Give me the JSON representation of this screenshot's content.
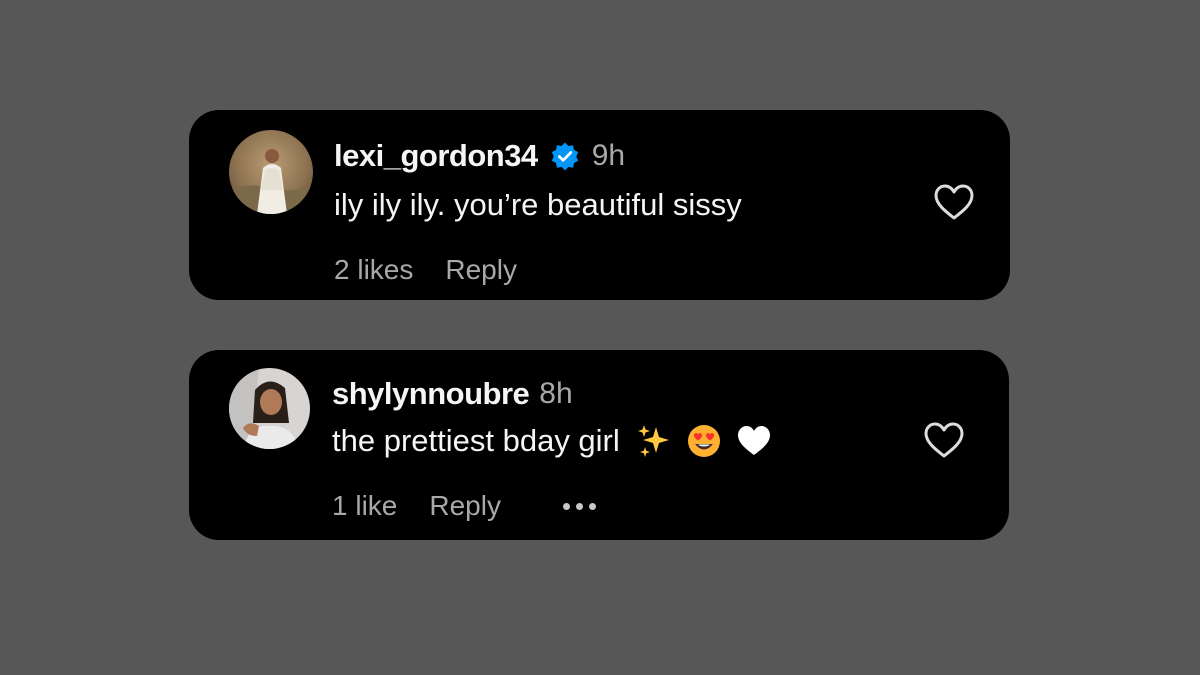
{
  "comments": [
    {
      "username": "lexi_gordon34",
      "verified": true,
      "time": "9h",
      "text": "ily ily ily. you’re beautiful sissy",
      "likes_label": "2 likes",
      "reply_label": "Reply",
      "emojis": []
    },
    {
      "username": "shylynnoubre",
      "verified": false,
      "time": "8h",
      "text": "the prettiest bday girl",
      "likes_label": "1 like",
      "reply_label": "Reply",
      "emojis": [
        "sparkles-emoji",
        "heart-eyes-emoji",
        "white-heart-emoji"
      ],
      "has_more_menu": true
    }
  ],
  "colors": {
    "background": "#575757",
    "card": "#000000",
    "primary_text": "#f5f5f5",
    "secondary_text": "#a8a8a8",
    "verified_blue": "#0095f6"
  },
  "icons": {
    "like": "heart-outline-icon",
    "verified": "verified-badge-icon",
    "more": "more-options-icon"
  }
}
